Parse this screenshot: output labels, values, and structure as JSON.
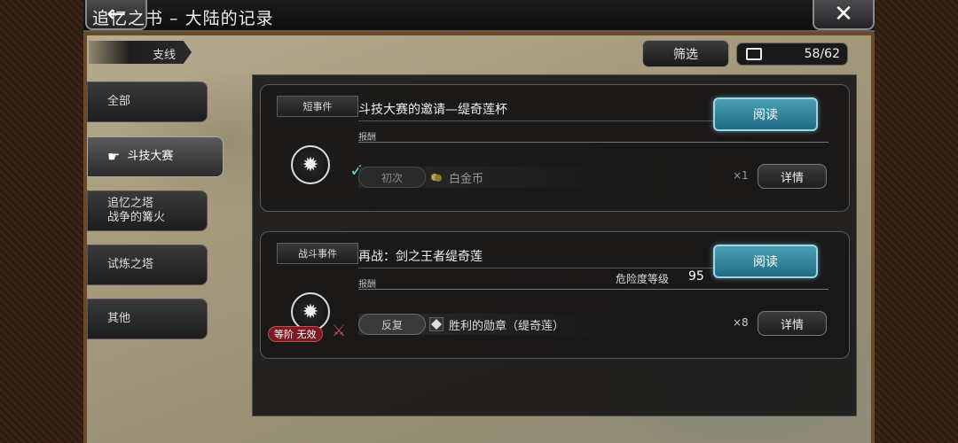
{
  "header": {
    "title": "追忆之书 – 大陆的记录",
    "back_icon": "←",
    "close_icon": "✕"
  },
  "sidebar": {
    "branch_label": "支线",
    "tabs": [
      {
        "label": "全部"
      },
      {
        "label": "斗技大赛",
        "active": true
      },
      {
        "label_line1": "追忆之塔",
        "label_line2": "战争的篝火"
      },
      {
        "label": "试炼之塔"
      },
      {
        "label": "其他"
      }
    ]
  },
  "toolbar": {
    "filter_label": "筛选",
    "counter": "58/62"
  },
  "events": [
    {
      "tag": "短事件",
      "title": "斗技大赛的邀请—缇奇莲杯",
      "reward_label": "报酬",
      "read_label": "阅读",
      "reward_kind": "初次",
      "reward_item": "白金币",
      "reward_qty": "×1",
      "detail_label": "详情",
      "completed": true
    },
    {
      "tag": "战斗事件",
      "title": "再战：剑之王者缇奇莲",
      "reward_label": "报酬",
      "read_label": "阅读",
      "danger_label": "危险度等级",
      "danger_value": "95",
      "reward_kind": "反复",
      "reward_item": "胜利的勋章（缇奇莲）",
      "reward_qty": "×8",
      "detail_label": "详情",
      "rank_badge": "等阶 无效"
    }
  ],
  "colors": {
    "read_button": "#2f87a0",
    "rank_badge": "#7a1a22",
    "check": "#5fd0d0"
  }
}
